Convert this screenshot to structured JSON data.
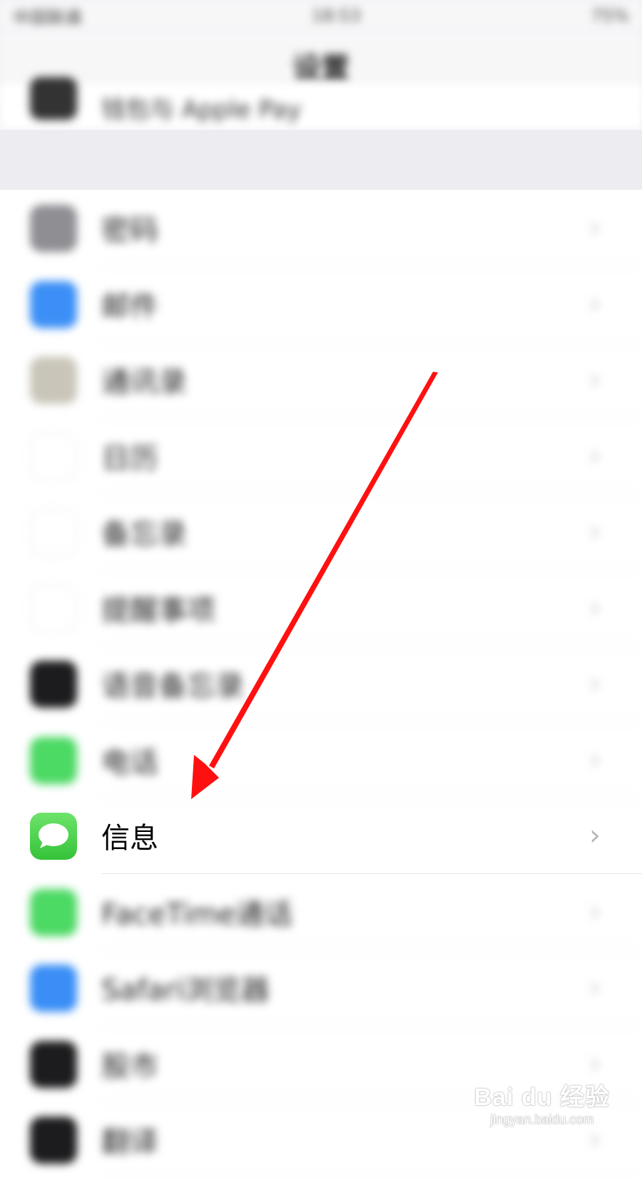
{
  "status_bar": {
    "carrier": "中国联通",
    "time": "18:53",
    "battery": "75%"
  },
  "nav": {
    "title": "设置"
  },
  "top_partial_row": {
    "label": "钱包与 Apple Pay"
  },
  "rows": [
    {
      "label": "密码",
      "icon": "key-icon",
      "color": "#8e8e93"
    },
    {
      "label": "邮件",
      "icon": "mail-icon",
      "color": "#3b8ff6"
    },
    {
      "label": "通讯录",
      "icon": "contacts-icon",
      "color": "#c9c5b8"
    },
    {
      "label": "日历",
      "icon": "calendar-icon",
      "color": "#ffffff"
    },
    {
      "label": "备忘录",
      "icon": "notes-icon",
      "color": "#ffffff"
    },
    {
      "label": "提醒事项",
      "icon": "reminders-icon",
      "color": "#ffffff"
    },
    {
      "label": "语音备忘录",
      "icon": "voice-memos-icon",
      "color": "#1c1c1e"
    },
    {
      "label": "电话",
      "icon": "phone-icon",
      "color": "#4cd964"
    },
    {
      "label": "信息",
      "icon": "messages-icon",
      "color": "#4cd964"
    },
    {
      "label": "FaceTime通话",
      "icon": "facetime-icon",
      "color": "#4cd964"
    },
    {
      "label": "Safari浏览器",
      "icon": "safari-icon",
      "color": "#3a8ef6"
    },
    {
      "label": "股市",
      "icon": "stocks-icon",
      "color": "#1c1c1e"
    },
    {
      "label": "翻译",
      "icon": "translate-icon",
      "color": "#1c1c1e"
    }
  ],
  "watermark": {
    "brand": "Bai du 经验",
    "url": "jingyan.baidu.com"
  },
  "arrow_color": "#ff1010"
}
